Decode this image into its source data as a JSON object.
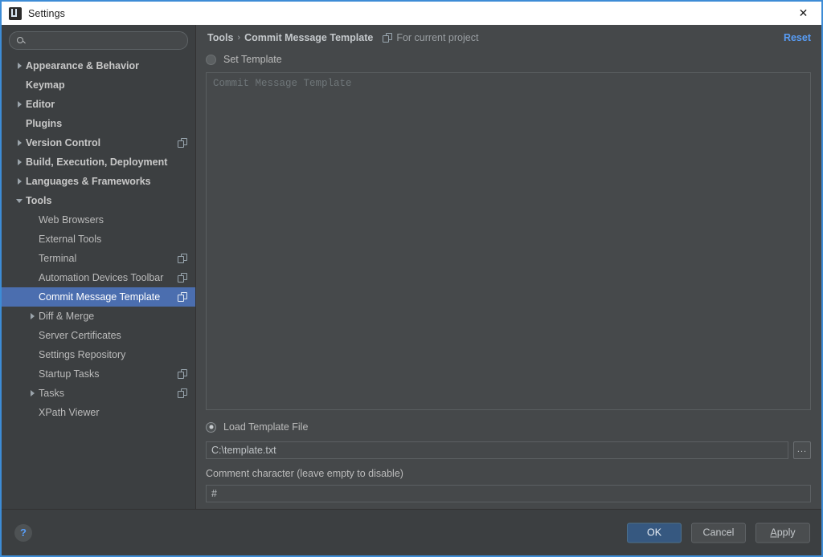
{
  "window": {
    "title": "Settings",
    "app_icon": "intellij-idea-icon",
    "close_label": "✕"
  },
  "sidebar": {
    "search": {
      "value": "",
      "placeholder": ""
    },
    "items": [
      {
        "label": "Appearance & Behavior",
        "arrow": "right",
        "bold": true,
        "indent": 0,
        "module_icon": false,
        "selected": false
      },
      {
        "label": "Keymap",
        "arrow": "none",
        "bold": true,
        "indent": 0,
        "module_icon": false,
        "selected": false
      },
      {
        "label": "Editor",
        "arrow": "right",
        "bold": true,
        "indent": 0,
        "module_icon": false,
        "selected": false
      },
      {
        "label": "Plugins",
        "arrow": "none",
        "bold": true,
        "indent": 0,
        "module_icon": false,
        "selected": false
      },
      {
        "label": "Version Control",
        "arrow": "right",
        "bold": true,
        "indent": 0,
        "module_icon": true,
        "selected": false
      },
      {
        "label": "Build, Execution, Deployment",
        "arrow": "right",
        "bold": true,
        "indent": 0,
        "module_icon": false,
        "selected": false
      },
      {
        "label": "Languages & Frameworks",
        "arrow": "right",
        "bold": true,
        "indent": 0,
        "module_icon": false,
        "selected": false
      },
      {
        "label": "Tools",
        "arrow": "down",
        "bold": true,
        "indent": 0,
        "module_icon": false,
        "selected": false
      },
      {
        "label": "Web Browsers",
        "arrow": "none",
        "bold": false,
        "indent": 1,
        "module_icon": false,
        "selected": false
      },
      {
        "label": "External Tools",
        "arrow": "none",
        "bold": false,
        "indent": 1,
        "module_icon": false,
        "selected": false
      },
      {
        "label": "Terminal",
        "arrow": "none",
        "bold": false,
        "indent": 1,
        "module_icon": true,
        "selected": false
      },
      {
        "label": "Automation Devices Toolbar",
        "arrow": "none",
        "bold": false,
        "indent": 1,
        "module_icon": true,
        "selected": false
      },
      {
        "label": "Commit Message Template",
        "arrow": "none",
        "bold": false,
        "indent": 1,
        "module_icon": true,
        "selected": true
      },
      {
        "label": "Diff & Merge",
        "arrow": "right",
        "bold": false,
        "indent": 1,
        "module_icon": false,
        "selected": false
      },
      {
        "label": "Server Certificates",
        "arrow": "none",
        "bold": false,
        "indent": 1,
        "module_icon": false,
        "selected": false
      },
      {
        "label": "Settings Repository",
        "arrow": "none",
        "bold": false,
        "indent": 1,
        "module_icon": false,
        "selected": false
      },
      {
        "label": "Startup Tasks",
        "arrow": "none",
        "bold": false,
        "indent": 1,
        "module_icon": true,
        "selected": false
      },
      {
        "label": "Tasks",
        "arrow": "right",
        "bold": false,
        "indent": 1,
        "module_icon": true,
        "selected": false
      },
      {
        "label": "XPath Viewer",
        "arrow": "none",
        "bold": false,
        "indent": 1,
        "module_icon": false,
        "selected": false
      }
    ]
  },
  "main": {
    "breadcrumb": {
      "root": "Tools",
      "separator": "›",
      "current": "Commit Message Template",
      "scope_icon": "project-module-icon",
      "scope_note": "For current project"
    },
    "reset_label": "Reset",
    "set_template": {
      "label": "Set Template",
      "selected": false
    },
    "template_textarea": {
      "placeholder": "Commit Message Template",
      "value": ""
    },
    "load_template_file": {
      "label": "Load Template File",
      "selected": true
    },
    "file_path": {
      "value": "C:\\template.txt",
      "placeholder": ""
    },
    "browse_button_label": "...",
    "comment_character": {
      "label": "Comment character (leave empty to disable)",
      "value": "#",
      "placeholder": ""
    }
  },
  "footer": {
    "help_label": "?",
    "ok_label": "OK",
    "cancel_label": "Cancel",
    "apply_mnemonic": "A",
    "apply_rest": "pply"
  },
  "colors": {
    "accent_blue": "#589df6",
    "selection_blue": "#4b6eaf",
    "default_button": "#365880",
    "panel_bg": "#45484a",
    "sidebar_bg": "#3c3f41",
    "focus_border": "#3d8cd6"
  }
}
